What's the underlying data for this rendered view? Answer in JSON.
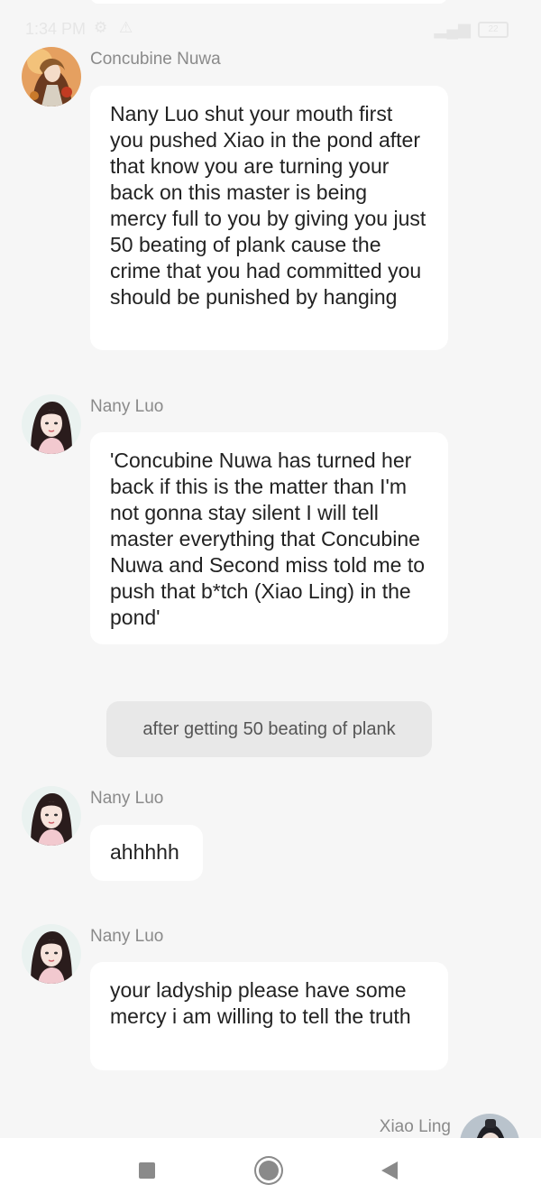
{
  "status_bar": {
    "time": "1:34 PM",
    "battery": "22"
  },
  "messages": [
    {
      "sender": "Concubine Nuwa",
      "text": "Nany Luo shut your  mouth first you pushed Xiao in the pond after that know you are turning your back on this master is being mercy full to you by giving you just 50 beating of plank cause the crime that you had committed you should be punished by hanging"
    },
    {
      "sender": "Nany Luo",
      "text": "'Concubine Nuwa has turned her back if this is the matter than I'm not gonna stay silent I will tell master everything that Concubine Nuwa and Second miss told me to push that b*tch (Xiao Ling) in the pond'"
    },
    {
      "sender": "Nany Luo",
      "text": "ahhhhh"
    },
    {
      "sender": "Nany Luo",
      "text": "your ladyship please have some mercy i am willing to tell the truth"
    },
    {
      "sender": "Xiao Ling"
    }
  ],
  "notice": "after getting 50 beating of plank",
  "nav": {
    "recents_icon": "square-icon",
    "home_icon": "circle-icon",
    "back_icon": "triangle-back-icon"
  },
  "colors": {
    "background": "#f6f6f6",
    "bubble": "#ffffff",
    "notice_bg": "#e8e8e8",
    "name_text": "#8a8a8a"
  }
}
